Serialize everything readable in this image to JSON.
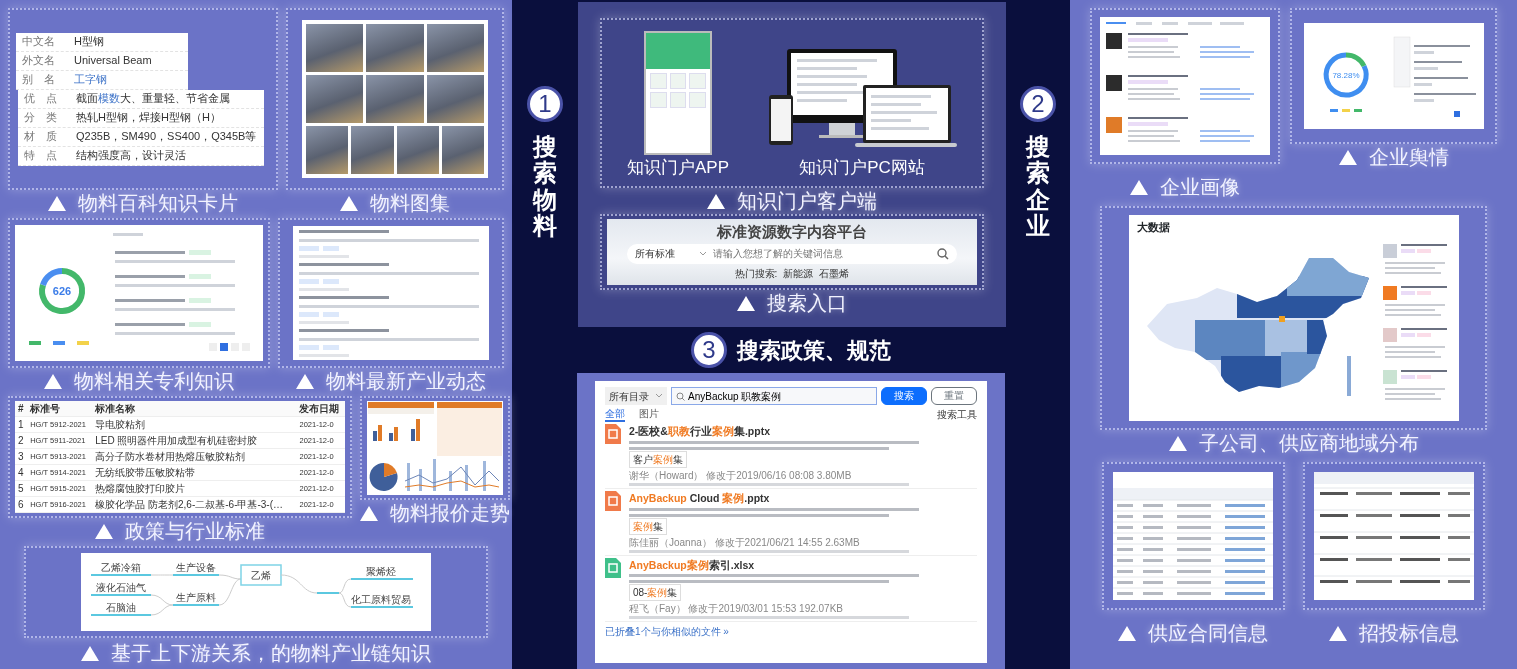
{
  "material": {
    "step": {
      "number": "1",
      "title": "搜索物料"
    },
    "encyclopedia_card": {
      "caption": "物料百科知识卡片",
      "rows": [
        {
          "label": "中文名",
          "value": [
            {
              "text": "H型钢",
              "link": false
            }
          ]
        },
        {
          "label": "外文名",
          "value": [
            {
              "text": "Universal Beam",
              "link": false
            }
          ]
        },
        {
          "label": "别　名",
          "value": [
            {
              "text": "工字钢",
              "link": true
            }
          ]
        },
        {
          "label": "优　点",
          "value": [
            {
              "text": "截面",
              "link": false
            },
            {
              "text": "模数",
              "link": true
            },
            {
              "text": "大、重量轻、节省金属",
              "link": false
            }
          ]
        },
        {
          "label": "分　类",
          "value": [
            {
              "text": "热轧H型钢，焊接H型钢（H）",
              "link": false
            }
          ]
        },
        {
          "label": "材　质",
          "value": [
            {
              "text": "Q235B，SM490，SS400，Q345B等",
              "link": false
            }
          ]
        },
        {
          "label": "特　点",
          "value": [
            {
              "text": "结构强度高，设计灵活",
              "link": false
            }
          ]
        }
      ]
    },
    "gallery": {
      "caption": "物料图集"
    },
    "patents": {
      "caption": "物料相关专利知识",
      "total": "626"
    },
    "news": {
      "caption": "物料最新产业动态"
    },
    "standards": {
      "caption": "政策与行业标准",
      "columns": [
        "#",
        "标准号",
        "标准名称",
        "发布日期"
      ],
      "rows": [
        [
          "1",
          "HG/T 5912-2021",
          "导电胶粘剂",
          "2021-12-0"
        ],
        [
          "2",
          "HG/T 5911-2021",
          "LED 照明器件用加成型有机硅密封胶",
          "2021-12-0"
        ],
        [
          "3",
          "HG/T 5913-2021",
          "高分子防水卷材用热熔压敏胶粘剂",
          "2021-12-0"
        ],
        [
          "4",
          "HG/T 5914-2021",
          "无纺纸胶带压敏胶粘带",
          "2021-12-0"
        ],
        [
          "5",
          "HG/T 5915-2021",
          "热熔腐蚀胶打印胶片",
          "2021-12-0"
        ],
        [
          "6",
          "HG/T 5916-2021",
          "橡胶化学品 防老剂2,6-二叔基-6-甲基-3-(…",
          "2021-12-0"
        ]
      ]
    },
    "price_trend": {
      "caption": "物料报价走势"
    },
    "industry_chain": {
      "caption": "基于上下游关系，的物料产业链知识",
      "center": "乙烯",
      "upstream": [
        {
          "label": "生产设备",
          "children": [
            {
              "label": "乙烯冷箱"
            }
          ]
        },
        {
          "label": "生产原料",
          "children": [
            {
              "label": "液化石油气"
            },
            {
              "label": "石脑油"
            }
          ]
        }
      ],
      "downstream": [
        {
          "label": "聚烯烃"
        },
        {
          "label": "化工原料贸易"
        }
      ]
    }
  },
  "portal": {
    "app_label": "知识门户APP",
    "pc_label": "知识门户PC网站",
    "caption": "知识门户客户端",
    "search_entry": {
      "title": "标准资源数字内容平台",
      "scope": "所有标准",
      "placeholder": "请输入您想了解的关键词信息",
      "hot_label": "热门搜索:",
      "hot_terms": [
        "新能源",
        "石墨烯"
      ]
    },
    "search_caption": "搜索入口"
  },
  "policy": {
    "step": {
      "number": "3",
      "title": "搜索政策、规范"
    },
    "search_results": {
      "scope": "所有目录",
      "query": "AnyBackup 职教案例",
      "search_button": "搜索",
      "reset_button": "重置",
      "tabs": [
        {
          "label": "全部",
          "selected": true
        },
        {
          "label": "图片",
          "selected": false
        }
      ],
      "tools": "搜索工具",
      "results": [
        {
          "kind": "pptx",
          "title": [
            {
              "text": "2-医校&",
              "highlight": false
            },
            {
              "text": "职教",
              "highlight": true
            },
            {
              "text": "行业",
              "highlight": false
            },
            {
              "text": "案例",
              "highlight": true
            },
            {
              "text": "集.pptx",
              "highlight": false
            }
          ],
          "tag": [
            {
              "text": "客户",
              "highlight": false
            },
            {
              "text": "案例",
              "highlight": true
            },
            {
              "text": "集",
              "highlight": false
            }
          ],
          "meta": "谢华（Howard）  修改于2019/06/16 08:08  3.80MB"
        },
        {
          "kind": "pptx",
          "title": [
            {
              "text": "AnyBackup",
              "highlight": true
            },
            {
              "text": " Cloud ",
              "highlight": false
            },
            {
              "text": "案例",
              "highlight": true
            },
            {
              "text": ".pptx",
              "highlight": false
            }
          ],
          "tag": [
            {
              "text": "案例",
              "highlight": true
            },
            {
              "text": "集",
              "highlight": false
            }
          ],
          "meta": "陈佳丽（Joanna）  修改于2021/06/21 14:55  2.63MB"
        },
        {
          "kind": "xlsx",
          "title": [
            {
              "text": "AnyBackup案例",
              "highlight": true
            },
            {
              "text": "索引.xlsx",
              "highlight": false
            }
          ],
          "tag": [
            {
              "text": "08-",
              "highlight": false
            },
            {
              "text": "案例",
              "highlight": true
            },
            {
              "text": "集",
              "highlight": false
            }
          ],
          "meta": "程飞（Fay）  修改于2019/03/01 15:53  192.07KB"
        }
      ],
      "footer": "已折叠1个与你相似的文件 »"
    }
  },
  "enterprise": {
    "step": {
      "number": "2",
      "title": "搜索企业"
    },
    "profile_caption": "企业画像",
    "sentiment": {
      "caption": "企业舆情",
      "rate": "78.28%"
    },
    "distribution": {
      "caption": "子公司、供应商地域分布",
      "title": "大数据"
    },
    "contracts_caption": "供应合同信息",
    "bids_caption": "招投标信息"
  }
}
